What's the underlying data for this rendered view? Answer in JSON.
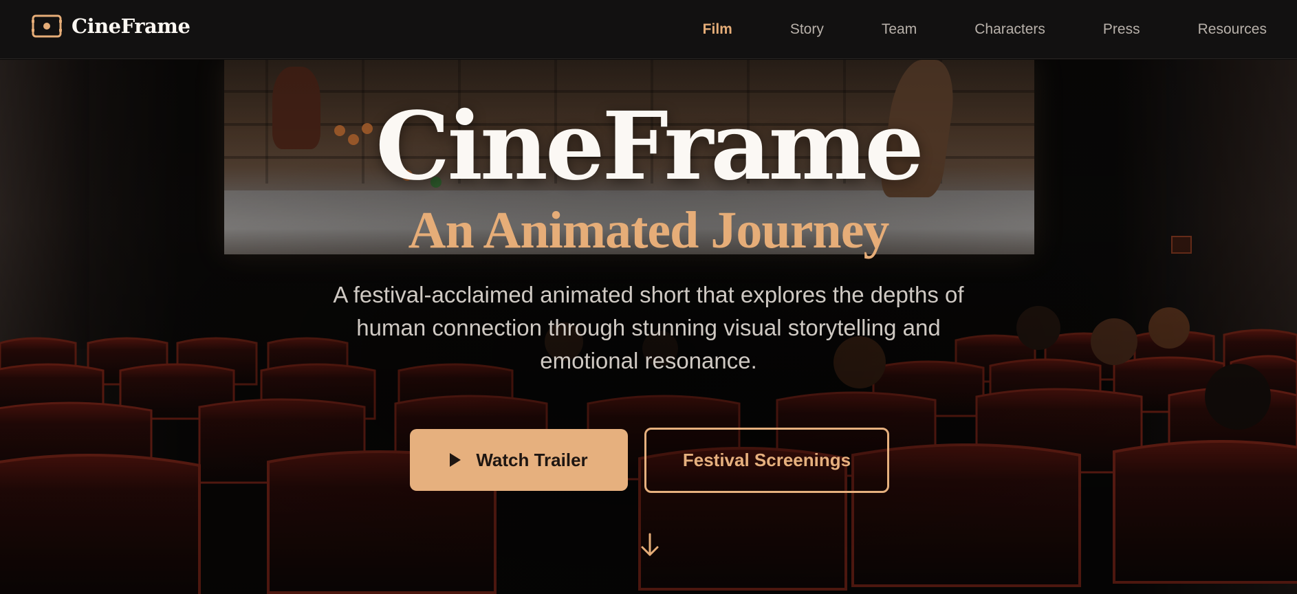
{
  "brand": {
    "name": "CineFrame",
    "icon": "film-frame-icon"
  },
  "nav": {
    "items": [
      {
        "label": "Film",
        "active": true
      },
      {
        "label": "Story",
        "active": false
      },
      {
        "label": "Team",
        "active": false
      },
      {
        "label": "Characters",
        "active": false
      },
      {
        "label": "Press",
        "active": false
      },
      {
        "label": "Resources",
        "active": false
      }
    ]
  },
  "hero": {
    "title": "CineFrame",
    "subtitle": "An Animated Journey",
    "description": "A festival-acclaimed animated short that explores the depths of human connection through stunning visual storytelling and emotional resonance.",
    "primary_button": {
      "label": "Watch Trailer",
      "icon": "play-icon"
    },
    "secondary_button": {
      "label": "Festival Screenings"
    },
    "scroll_icon": "arrow-down-icon"
  },
  "colors": {
    "accent": "#e6ad78",
    "nav_bg": "#121111",
    "text_light": "#fbf8f4",
    "nav_text": "#b8b1aa"
  }
}
